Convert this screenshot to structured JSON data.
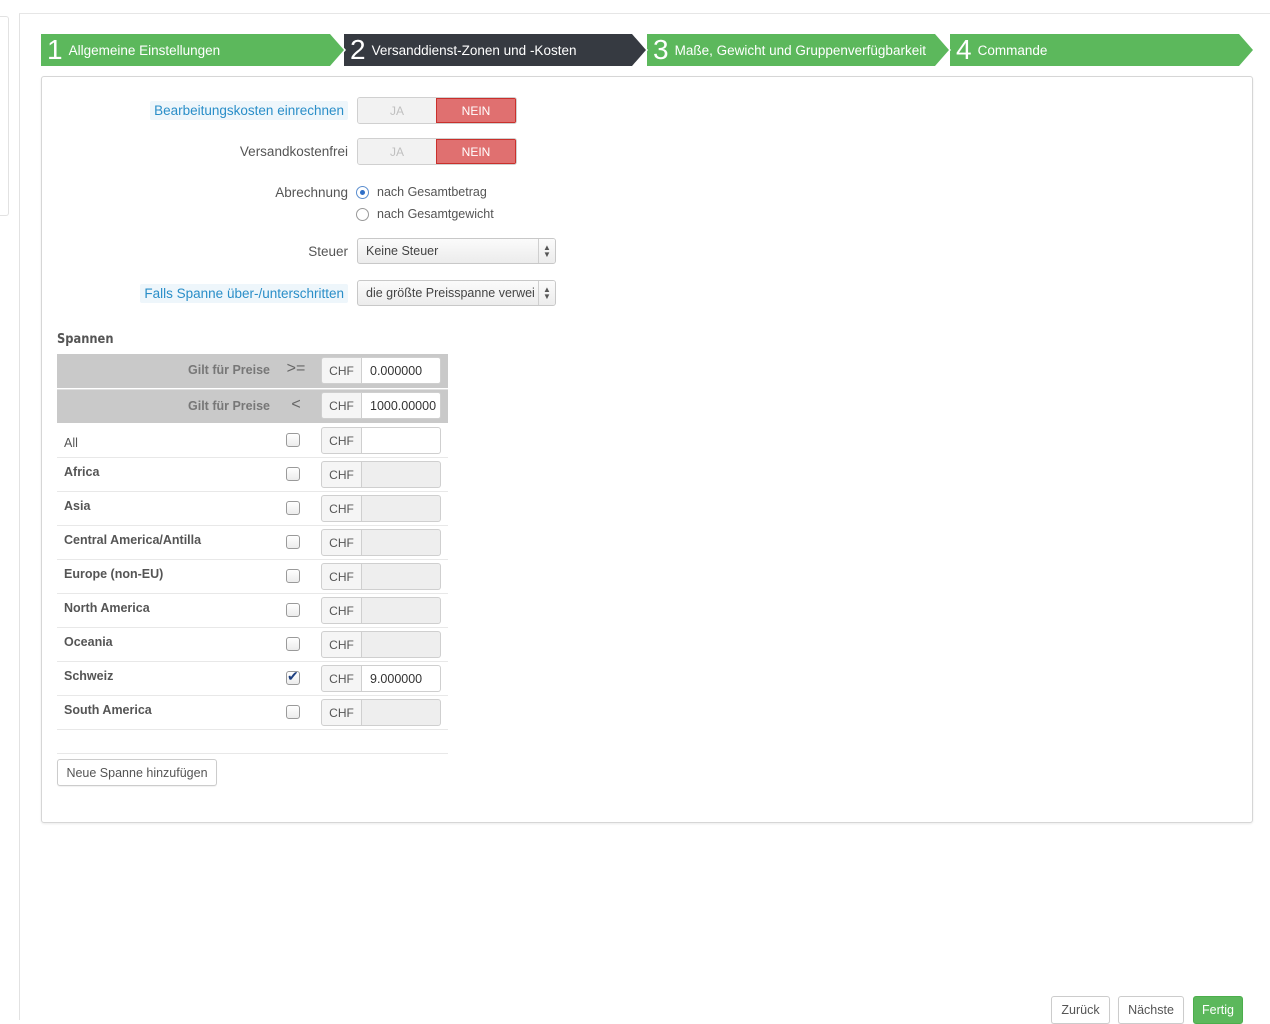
{
  "wizard": {
    "steps": [
      {
        "num": "1",
        "label": "Allgemeine Einstellungen"
      },
      {
        "num": "2",
        "label": "Versanddienst-Zonen und -Kosten"
      },
      {
        "num": "3",
        "label": "Maße, Gewicht und Gruppenverfügbarkeit"
      },
      {
        "num": "4",
        "label": "Commande"
      }
    ],
    "active_step": 2
  },
  "form": {
    "handling_fees": {
      "label": "Bearbeitungskosten einrechnen",
      "yes": "JA",
      "no": "NEIN",
      "value": "NEIN"
    },
    "free_shipping": {
      "label": "Versandkostenfrei",
      "yes": "JA",
      "no": "NEIN",
      "value": "NEIN"
    },
    "billing": {
      "label": "Abrechnung",
      "options": [
        "nach Gesamtbetrag",
        "nach Gesamtgewicht"
      ],
      "selected": "nach Gesamtbetrag"
    },
    "tax": {
      "label": "Steuer",
      "value": "Keine Steuer"
    },
    "out_of_range": {
      "label": "Falls Spanne über-/unterschritten",
      "value": "die größte Preisspanne verwei"
    }
  },
  "ranges": {
    "title": "Spannen",
    "header_label": "Gilt für Preise",
    "currency": "CHF",
    "from": {
      "op": ">=",
      "value": "0.000000"
    },
    "to": {
      "op": "<",
      "value": "1000.00000"
    },
    "zones": [
      {
        "name": "All",
        "checked": false,
        "value": "",
        "bold": false,
        "enabled": true
      },
      {
        "name": "Africa",
        "checked": false,
        "value": "",
        "bold": true,
        "enabled": false
      },
      {
        "name": "Asia",
        "checked": false,
        "value": "",
        "bold": true,
        "enabled": false
      },
      {
        "name": "Central America/Antilla",
        "checked": false,
        "value": "",
        "bold": true,
        "enabled": false
      },
      {
        "name": "Europe (non-EU)",
        "checked": false,
        "value": "",
        "bold": true,
        "enabled": false
      },
      {
        "name": "North America",
        "checked": false,
        "value": "",
        "bold": true,
        "enabled": false
      },
      {
        "name": "Oceania",
        "checked": false,
        "value": "",
        "bold": true,
        "enabled": false
      },
      {
        "name": "Schweiz",
        "checked": true,
        "value": "9.000000",
        "bold": true,
        "enabled": true
      },
      {
        "name": "South America",
        "checked": false,
        "value": "",
        "bold": true,
        "enabled": false
      }
    ],
    "add_button": "Neue Spanne hinzufügen"
  },
  "footer": {
    "back": "Zurück",
    "next": "Nächste",
    "finish": "Fertig"
  },
  "colors": {
    "step_done": "#5cb85c",
    "step_active": "#363a41",
    "switch_no": "#e07070",
    "primary": "#5cb85c"
  }
}
